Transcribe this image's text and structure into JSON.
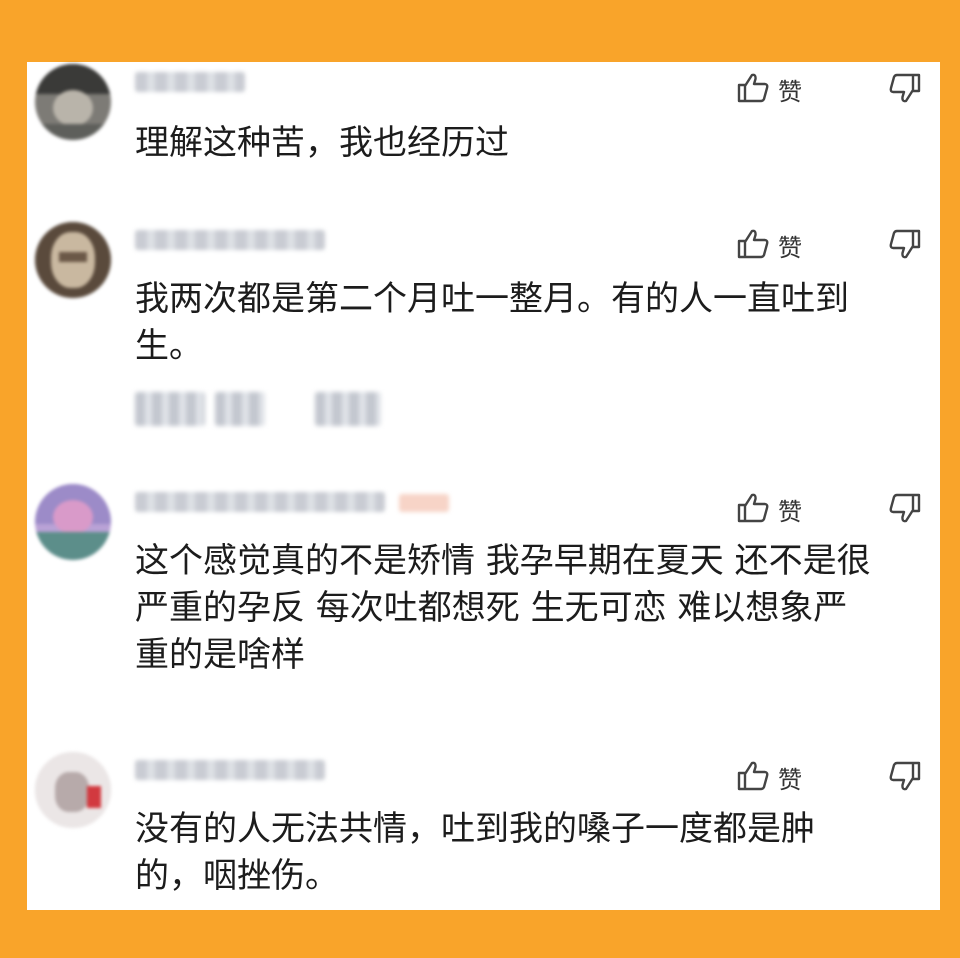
{
  "actions": {
    "like_label": "赞"
  },
  "comments": [
    {
      "text": "理解这种苦，我也经历过"
    },
    {
      "text": "我两次都是第二个月吐一整月。有的人一直吐到\n生。"
    },
    {
      "text": "这个感觉真的不是矫情 我孕早期在夏天 还不是很\n严重的孕反 每次吐都想死 生无可恋 难以想象严\n重的是啥样"
    },
    {
      "text": "没有的人无法共情，吐到我的嗓子一度都是肿\n的，咽挫伤。"
    }
  ],
  "icons": {
    "like": "thumbs-up-icon",
    "dislike": "thumbs-down-icon"
  },
  "colors": {
    "frame": "#f9a42a",
    "card": "#ffffff",
    "text": "#1c1c1c"
  }
}
